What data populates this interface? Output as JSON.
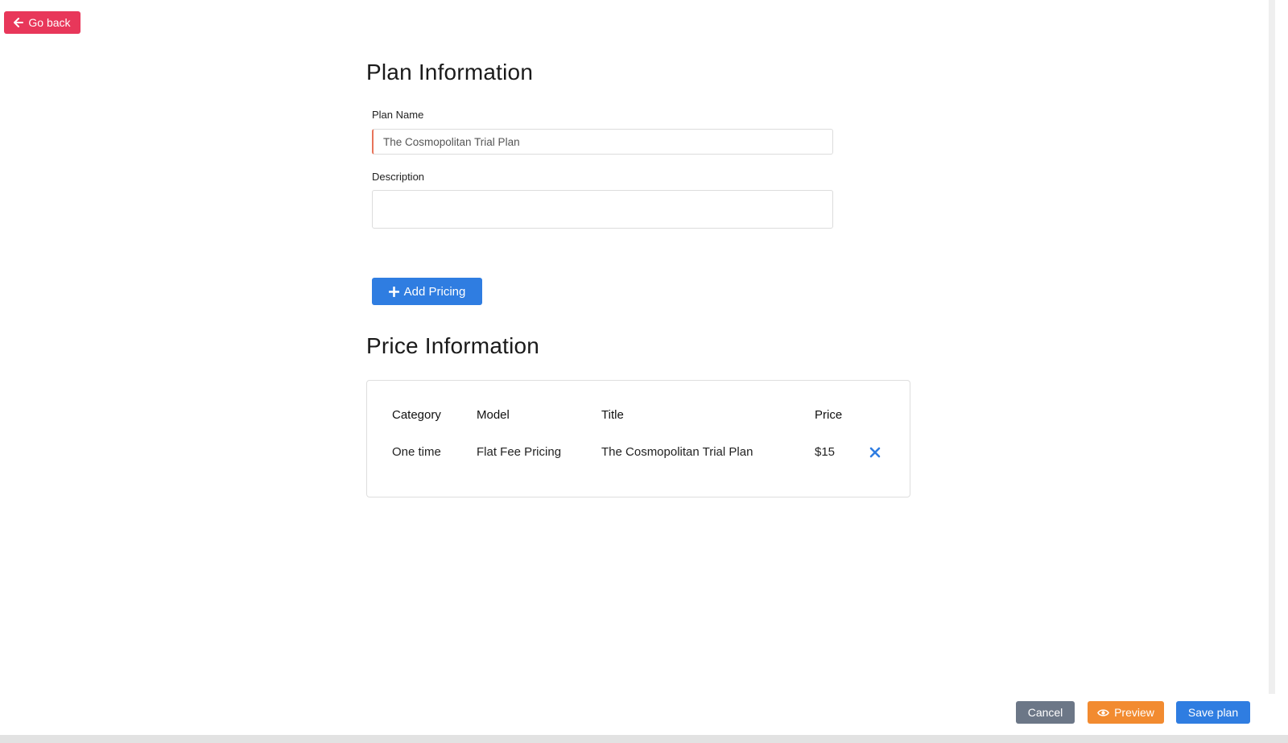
{
  "nav": {
    "go_back_label": "Go back"
  },
  "plan_info": {
    "heading": "Plan Information",
    "plan_name_label": "Plan Name",
    "plan_name_value": "The Cosmopolitan Trial Plan",
    "description_label": "Description",
    "description_value": ""
  },
  "add_pricing_label": "Add Pricing",
  "price_info": {
    "heading": "Price Information",
    "columns": [
      "Category",
      "Model",
      "Title",
      "Price"
    ],
    "rows": [
      {
        "category": "One time",
        "model": "Flat Fee Pricing",
        "title": "The Cosmopolitan Trial Plan",
        "price": "$15"
      }
    ]
  },
  "footer": {
    "cancel_label": "Cancel",
    "preview_label": "Preview",
    "save_label": "Save plan"
  },
  "icons": {
    "go_back": "arrow-left-icon",
    "add": "plus-icon",
    "remove": "close-icon",
    "preview": "eye-icon"
  },
  "colors": {
    "danger": "#e8375a",
    "primary": "#2f7de1",
    "secondary": "#6c7787",
    "warning": "#f28b30"
  }
}
